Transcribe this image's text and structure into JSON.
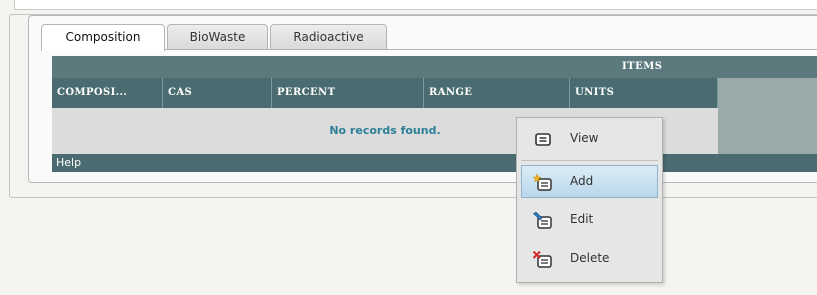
{
  "tabs": [
    {
      "label": "Composition",
      "active": true
    },
    {
      "label": "BioWaste",
      "active": false
    },
    {
      "label": "Radioactive",
      "active": false
    }
  ],
  "grid": {
    "group_header": "ITEMS",
    "columns": [
      "COMPOSI...",
      "CAS",
      "PERCENT",
      "RANGE",
      "UNITS"
    ],
    "empty_message": "No records found.",
    "footer_label": "Help"
  },
  "context_menu": {
    "items": [
      {
        "label": "View",
        "icon": "view-icon",
        "highlighted": false
      },
      {
        "label": "Add",
        "icon": "add-icon",
        "highlighted": true
      },
      {
        "label": "Edit",
        "icon": "edit-icon",
        "highlighted": false
      },
      {
        "label": "Delete",
        "icon": "delete-icon",
        "highlighted": false
      }
    ]
  },
  "colors": {
    "grid_header": "#4a6c70",
    "empty_text": "#2b7f96",
    "menu_highlight": "#b9d7ea"
  }
}
